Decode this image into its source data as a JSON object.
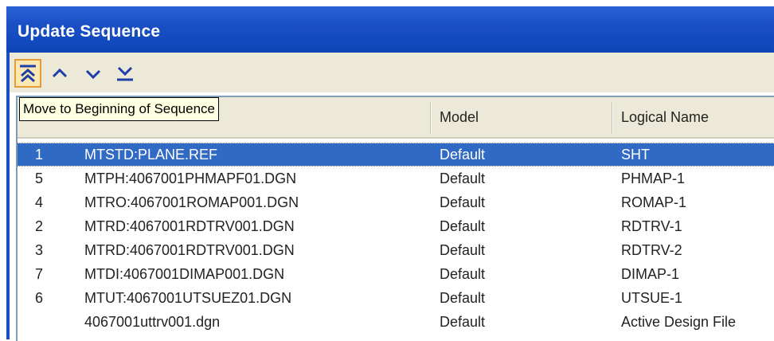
{
  "window": {
    "title": "Update Sequence"
  },
  "toolbar": {
    "buttons": [
      {
        "name": "move-to-beginning",
        "icon": "double-chevron-up-bar-icon"
      },
      {
        "name": "move-up",
        "icon": "chevron-up-icon"
      },
      {
        "name": "move-down",
        "icon": "chevron-down-icon"
      },
      {
        "name": "move-to-end",
        "icon": "chevron-down-bar-icon"
      }
    ],
    "tooltip": "Move to Beginning of Sequence"
  },
  "list": {
    "columns": [
      "Model",
      "Logical Name"
    ],
    "rows": [
      {
        "num": "1",
        "file": "MTSTD:PLANE.REF",
        "model": "Default",
        "logical": "SHT",
        "selected": true
      },
      {
        "num": "5",
        "file": "MTPH:4067001PHMAPF01.DGN",
        "model": "Default",
        "logical": "PHMAP-1"
      },
      {
        "num": "4",
        "file": "MTRO:4067001ROMAP001.DGN",
        "model": "Default",
        "logical": "ROMAP-1"
      },
      {
        "num": "2",
        "file": "MTRD:4067001RDTRV001.DGN",
        "model": "Default",
        "logical": "RDTRV-1"
      },
      {
        "num": "3",
        "file": "MTRD:4067001RDTRV001.DGN",
        "model": "Default",
        "logical": "RDTRV-2"
      },
      {
        "num": "7",
        "file": "MTDI:4067001DIMAP001.DGN",
        "model": "Default",
        "logical": "DIMAP-1"
      },
      {
        "num": "6",
        "file": "MTUT:4067001UTSUEZ01.DGN",
        "model": "Default",
        "logical": "UTSUE-1"
      },
      {
        "num": "",
        "file": "4067001uttrv001.dgn",
        "model": "Default",
        "logical": "Active Design File"
      }
    ]
  },
  "colors": {
    "titlebar": "#1a4fc4",
    "selection": "#316ac5",
    "icon": "#1e3fa8",
    "active_button": "#fde7b3"
  }
}
